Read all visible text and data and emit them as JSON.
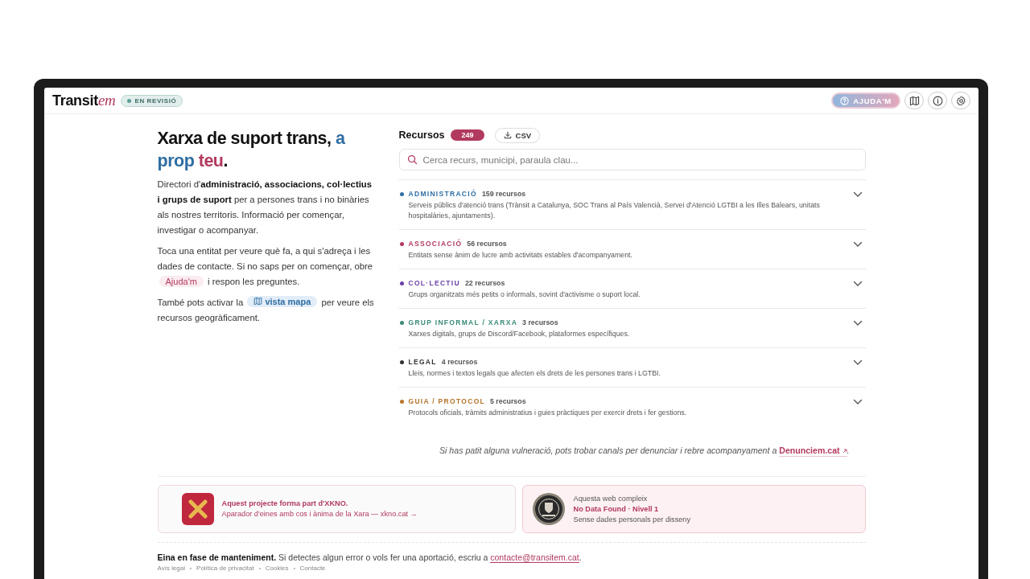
{
  "header": {
    "logo": {
      "main": "Transit",
      "accent": "em"
    },
    "status_badge": "EN REVISIÓ",
    "help_button": "AJUDA'M"
  },
  "intro": {
    "title": [
      {
        "text": "Xarxa de suport trans, ",
        "color": "#111111"
      },
      {
        "text": "a prop",
        "color": "#2f6ea3"
      },
      {
        "text": " teu",
        "color": "#b23a5e"
      },
      {
        "text": ".",
        "color": "#111111"
      }
    ],
    "paragraphs": [
      {
        "before": "Directori d'**administració, associacions, col·lectius i grups de suport** per a persones trans i no binàries als nostres territoris. Informació per començar, investigar o acompanyar."
      },
      {
        "before": "Toca una entitat per veure què fa, a qui s'adreça i les dades de contacte. Si no saps per on començar, obre ",
        "chip": {
          "kind": "help",
          "label": "Ajuda'm"
        },
        "after": " i respon les preguntes."
      },
      {
        "before": "També pots activar la ",
        "chip": {
          "kind": "map",
          "label": "vista mapa"
        },
        "after": " per veure els recursos geogràficament."
      }
    ]
  },
  "resources": {
    "title": "Recursos",
    "count": "249",
    "csv_button": "CSV",
    "search": {
      "placeholder": "Cerca recurs, municipi, paraula clau..."
    },
    "categories": [
      {
        "name": "ADMINISTRACIÓ",
        "count": "159 recursos",
        "description": "Serveis públics d'atenció trans (Trànsit a Catalunya, SOC Trans al País Valencià, Servei d'Atenció LGTBI a les Illes Balears, unitats hospitalàries, ajuntaments).",
        "color": "#2f6ea3"
      },
      {
        "name": "ASSOCIACIÓ",
        "count": "56 recursos",
        "description": "Entitats sense ànim de lucre amb activitats estables d'acompanyament.",
        "color": "#b23a5e"
      },
      {
        "name": "COL·LECTIU",
        "count": "22 recursos",
        "description": "Grups organitzats més petits o informals, sovint d'activisme o suport local.",
        "color": "#6a3fa8"
      },
      {
        "name": "GRUP INFORMAL / XARXA",
        "count": "3 recursos",
        "description": "Xarxes digitals, grups de Discord/Facebook, plataformes específiques.",
        "color": "#3a8a78"
      },
      {
        "name": "LEGAL",
        "count": "4 recursos",
        "description": "Lleis, normes i textos legals que afecten els drets de les persones trans i LGTBI.",
        "color": "#333333"
      },
      {
        "name": "GUIA / PROTOCOL",
        "count": "5 recursos",
        "description": "Protocols oficials, tràmits administratius i guies pràctiques per exercir drets i fer gestions.",
        "color": "#b5752a"
      }
    ]
  },
  "report_note": {
    "text": "Si has patit alguna vulneració, pots trobar canals per denunciar i rebre acompanyament a ",
    "link": "Denunciem.cat",
    "end": "."
  },
  "cards": {
    "xkno": {
      "title": "Aquest projecte forma part d'XKNO.",
      "subtitle": "Aparador d'eines amb cos i ànima de la Xara — xkno.cat →"
    },
    "ndf": {
      "lead": "Aquesta web compleix",
      "title": "No Data Found · Nivell 1",
      "subtitle": "Sense dades personals per disseny"
    }
  },
  "footer": {
    "bold": "Eina en fase de manteniment.",
    "text": " Si detectes algun error o vols fer una aportació, escriu a ",
    "email": "contacte@transitem.cat",
    "end": ".",
    "links": [
      "Avís legal",
      "Política de privacitat",
      "Cookies",
      "Contacte"
    ]
  }
}
